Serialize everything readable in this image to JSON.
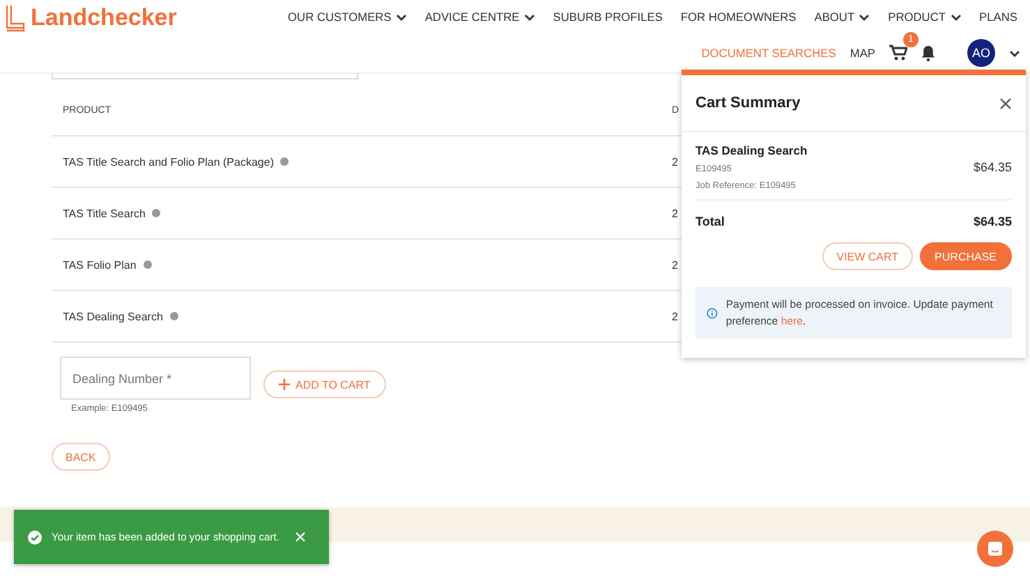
{
  "header": {
    "logo": "Landchecker",
    "nav": [
      {
        "label": "OUR CUSTOMERS",
        "dropdown": true
      },
      {
        "label": "ADVICE CENTRE",
        "dropdown": true
      },
      {
        "label": "SUBURB PROFILES",
        "dropdown": false
      },
      {
        "label": "FOR HOMEOWNERS",
        "dropdown": false
      },
      {
        "label": "ABOUT",
        "dropdown": true
      },
      {
        "label": "PRODUCT",
        "dropdown": true
      },
      {
        "label": "PLANS",
        "dropdown": false
      }
    ],
    "subnav": [
      {
        "label": "DOCUMENT SEARCHES",
        "selected": true
      },
      {
        "label": "MAP",
        "selected": false
      }
    ],
    "cart_badge": "1",
    "avatar": "AO"
  },
  "table": {
    "columns": [
      "PRODUCT",
      "D"
    ],
    "rows": [
      {
        "product": "TAS Title Search and Folio Plan (Package)",
        "column_2": "2"
      },
      {
        "product": "TAS Title Search",
        "column_2": "2"
      },
      {
        "product": "TAS Folio Plan",
        "column_2": "2"
      },
      {
        "product": "TAS Dealing Search",
        "column_2": "2"
      }
    ]
  },
  "form": {
    "placeholder": "Dealing Number *",
    "hint": "Example: E109495",
    "add_button": "ADD TO CART",
    "back_button": "BACK"
  },
  "cart": {
    "title": "Cart Summary",
    "item": {
      "name": "TAS Dealing Search",
      "code": "E109495",
      "reference": "Job Reference: E109495",
      "price": "$64.35"
    },
    "total_label": "Total",
    "total": "$64.35",
    "view_button": "VIEW CART",
    "purchase_button": "PURCHASE",
    "notice": "Payment will be processed on invoice. Update payment preference ",
    "notice_link": "here",
    "notice_end": "."
  },
  "toast": {
    "message": "Your item has been added to your shopping cart."
  }
}
